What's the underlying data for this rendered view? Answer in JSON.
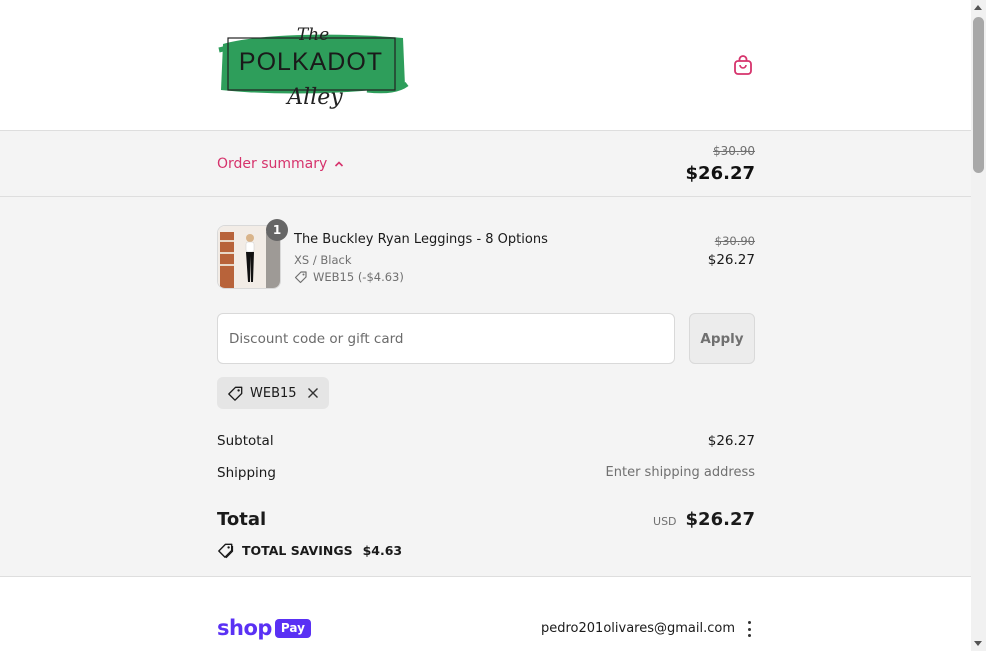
{
  "colors": {
    "accent": "#d6336c",
    "logo_green": "#2e9e5b",
    "shop_purple": "#5a31f4",
    "panel_bg": "#f4f4f4"
  },
  "header": {
    "logo_name": "The Polkadot Alley",
    "logo_the": "The",
    "logo_main": "POLKADOT",
    "logo_alley": "Alley",
    "cart_icon": "shopping-bag-icon"
  },
  "summary_bar": {
    "toggle_label": "Order summary",
    "original_total": "$30.90",
    "total": "$26.27"
  },
  "product": {
    "quantity": "1",
    "name": "The Buckley Ryan Leggings - 8 Options",
    "variant": "XS / Black",
    "discount": "WEB15 (-$4.63)",
    "original_price": "$30.90",
    "price": "$26.27"
  },
  "discount": {
    "placeholder": "Discount code or gift card",
    "value": "",
    "apply_label": "Apply",
    "applied_code": "WEB15"
  },
  "totals": {
    "subtotal_label": "Subtotal",
    "subtotal_value": "$26.27",
    "shipping_label": "Shipping",
    "shipping_value": "Enter shipping address",
    "total_label": "Total",
    "currency": "USD",
    "total_value": "$26.27",
    "savings_label": "TOTAL SAVINGS",
    "savings_value": "$4.63"
  },
  "shop_pay": {
    "shop_word": "shop",
    "pay_word": "Pay",
    "email": "pedro201olivares@gmail.com"
  }
}
